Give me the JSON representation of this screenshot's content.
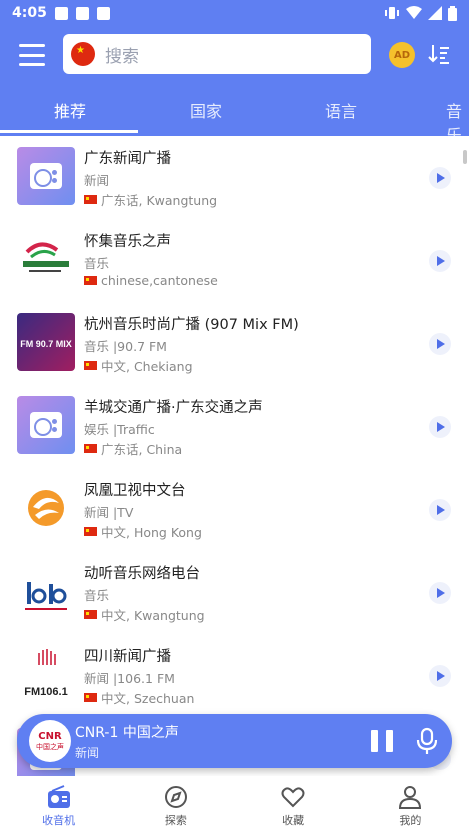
{
  "status_bar": {
    "time": "4:05",
    "icons": [
      "notification-square-icon",
      "radio-icon",
      "a-icon",
      "vibrate-icon",
      "wifi-icon",
      "signal-icon",
      "battery-icon"
    ]
  },
  "header": {
    "search_placeholder": "搜索",
    "ad_badge": "AD",
    "icons": [
      "menu-icon",
      "china-flag-icon",
      "ad-badge-icon",
      "sort-icon"
    ]
  },
  "tabs": [
    {
      "label": "推荐",
      "active": true
    },
    {
      "label": "国家",
      "active": false
    },
    {
      "label": "语言",
      "active": false
    },
    {
      "label": "音乐",
      "active": false
    }
  ],
  "stations": [
    {
      "title": "广东新闻广播",
      "category": "新闻",
      "lang": "广东话, Kwangtung",
      "logo": "radio"
    },
    {
      "title": "怀集音乐之声",
      "category": "音乐",
      "lang": "chinese,cantonese",
      "logo": "huaiji"
    },
    {
      "title": "杭州音乐时尚广播 (907 Mix FM)",
      "category": "音乐 |90.7 FM",
      "lang": "中文, Chekiang",
      "logo": "mixfm",
      "logo_text": "FM 90.7 MIX"
    },
    {
      "title": "羊城交通广播·广东交通之声",
      "category": "娱乐 |Traffic",
      "lang": "广东话, China",
      "logo": "radio"
    },
    {
      "title": "凤凰卫视中文台",
      "category": "新闻 |TV",
      "lang": "中文, Hong Kong",
      "logo": "phoenix"
    },
    {
      "title": "动听音乐网络电台",
      "category": "音乐",
      "lang": "中文, Kwangtung",
      "logo": "dongting"
    },
    {
      "title": "四川新闻广播",
      "category": "新闻 |106.1 FM",
      "lang": "中文, Szechuan",
      "logo": "sichuan",
      "logo_text": "FM106.1"
    }
  ],
  "player": {
    "title": "CNR-1 中国之声",
    "subtitle": "新闻",
    "logo_text": "CNR",
    "logo_sub": "中国之声"
  },
  "bottom_nav": [
    {
      "label": "收音机",
      "icon": "radio-icon",
      "active": true
    },
    {
      "label": "探索",
      "icon": "compass-icon",
      "active": false
    },
    {
      "label": "收藏",
      "icon": "heart-icon",
      "active": false
    },
    {
      "label": "我的",
      "icon": "person-icon",
      "active": false
    }
  ],
  "colors": {
    "primary": "#5f7ff2",
    "accent": "#4f6ee8"
  }
}
